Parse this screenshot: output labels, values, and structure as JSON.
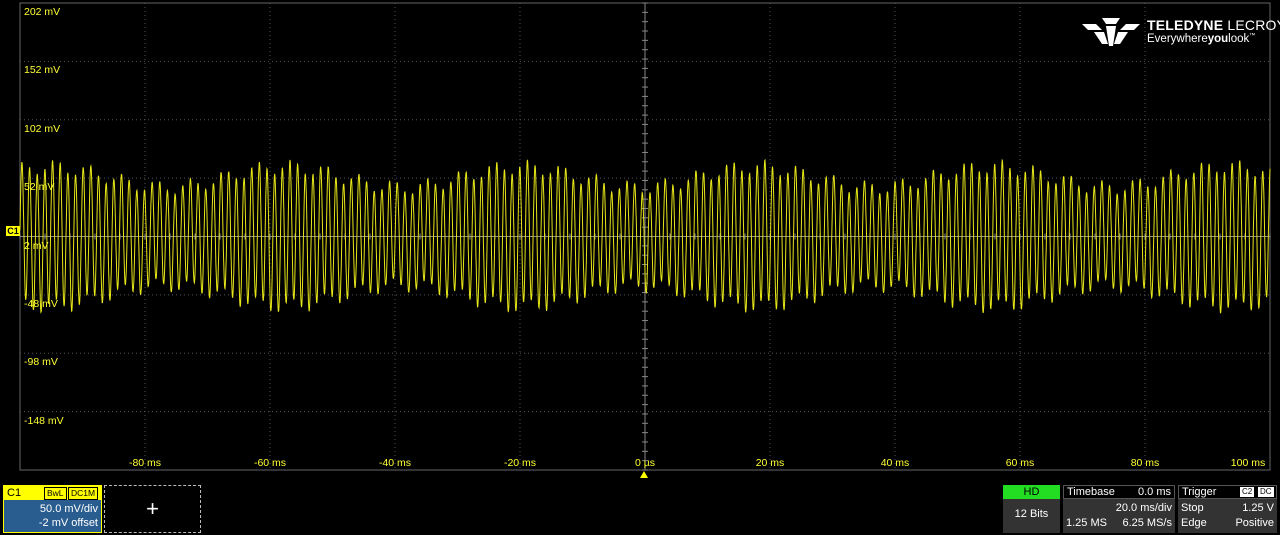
{
  "channel": {
    "marker": "C1",
    "name": "C1",
    "bandwidth_tag": "BwL",
    "coupling_tag": "DC1M",
    "volts_per_div": "50.0 mV/div",
    "offset": "-2 mV offset",
    "trace_color": "#e6e619"
  },
  "y_axis_labels": [
    "202 mV",
    "152 mV",
    "102 mV",
    "52 mV",
    "2 mV",
    "-48 mV",
    "-98 mV",
    "-148 mV"
  ],
  "x_axis_labels": [
    "-80 ms",
    "-60 ms",
    "-40 ms",
    "-20 ms",
    "0 µs",
    "20 ms",
    "40 ms",
    "60 ms",
    "80 ms",
    "100 ms"
  ],
  "logo": {
    "brand_bold": "TELEDYNE",
    "brand_light": "LECROY",
    "tagline_1": "Everywhere",
    "tagline_2": "you",
    "tagline_3": "look",
    "trademark": "™"
  },
  "add_button": {
    "label": "+"
  },
  "acquisition": {
    "mode": "HD",
    "bits": "12 Bits",
    "mode_color": "#22dd22"
  },
  "timebase": {
    "title": "Timebase",
    "delay": "0.0 ms",
    "time_per_div": "20.0 ms/div",
    "samples": "1.25 MS",
    "sample_rate": "6.25 MS/s"
  },
  "trigger": {
    "title": "Trigger",
    "source": "C2",
    "coupling": "DC",
    "state": "Stop",
    "level": "1.25 V",
    "type": "Edge",
    "slope": "Positive"
  },
  "chart_data": {
    "type": "line",
    "x_unit": "ms",
    "y_unit": "mV",
    "xlim": [
      -100,
      100
    ],
    "ylim": [
      -198,
      202
    ],
    "grid": true,
    "series": [
      {
        "name": "C1",
        "center_mV": 2,
        "peak_amplitude_mV": 60,
        "envelope_min_mV": 40,
        "carrier_cycles_visible": 160
      }
    ]
  }
}
